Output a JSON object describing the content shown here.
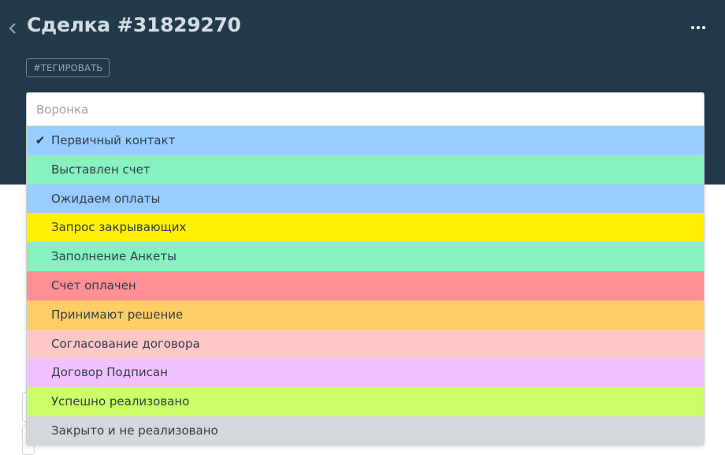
{
  "header": {
    "title": "Сделка #31829270",
    "tag_button_label": "#ТЕГИРОВАТЬ",
    "more_icon": "more-dots-icon",
    "back_icon": "chevron-left-icon",
    "background_color": "#223a4a"
  },
  "pipeline_select": {
    "placeholder": "Воронка",
    "value": "",
    "selected_index": 0,
    "options": [
      {
        "label": "Первичный контакт",
        "color": "#99ccff",
        "selected": true
      },
      {
        "label": "Выставлен счет",
        "color": "#87f2c0",
        "selected": false
      },
      {
        "label": "Ожидаем оплаты",
        "color": "#99ccff",
        "selected": false
      },
      {
        "label": "Запрос закрывающих",
        "color": "#fff000",
        "selected": false
      },
      {
        "label": "Заполнение Анкеты",
        "color": "#87f2c0",
        "selected": false
      },
      {
        "label": "Счет оплачен",
        "color": "#ff8f92",
        "selected": false
      },
      {
        "label": "Принимают решение",
        "color": "#ffcc66",
        "selected": false
      },
      {
        "label": "Согласование договора",
        "color": "#ffc8c8",
        "selected": false
      },
      {
        "label": "Договор Подписан",
        "color": "#f1c1ff",
        "selected": false
      },
      {
        "label": "Успешно реализовано",
        "color": "#ccff66",
        "selected": false
      },
      {
        "label": "Закрыто и не реализовано",
        "color": "#d5d8db",
        "selected": false
      }
    ]
  }
}
